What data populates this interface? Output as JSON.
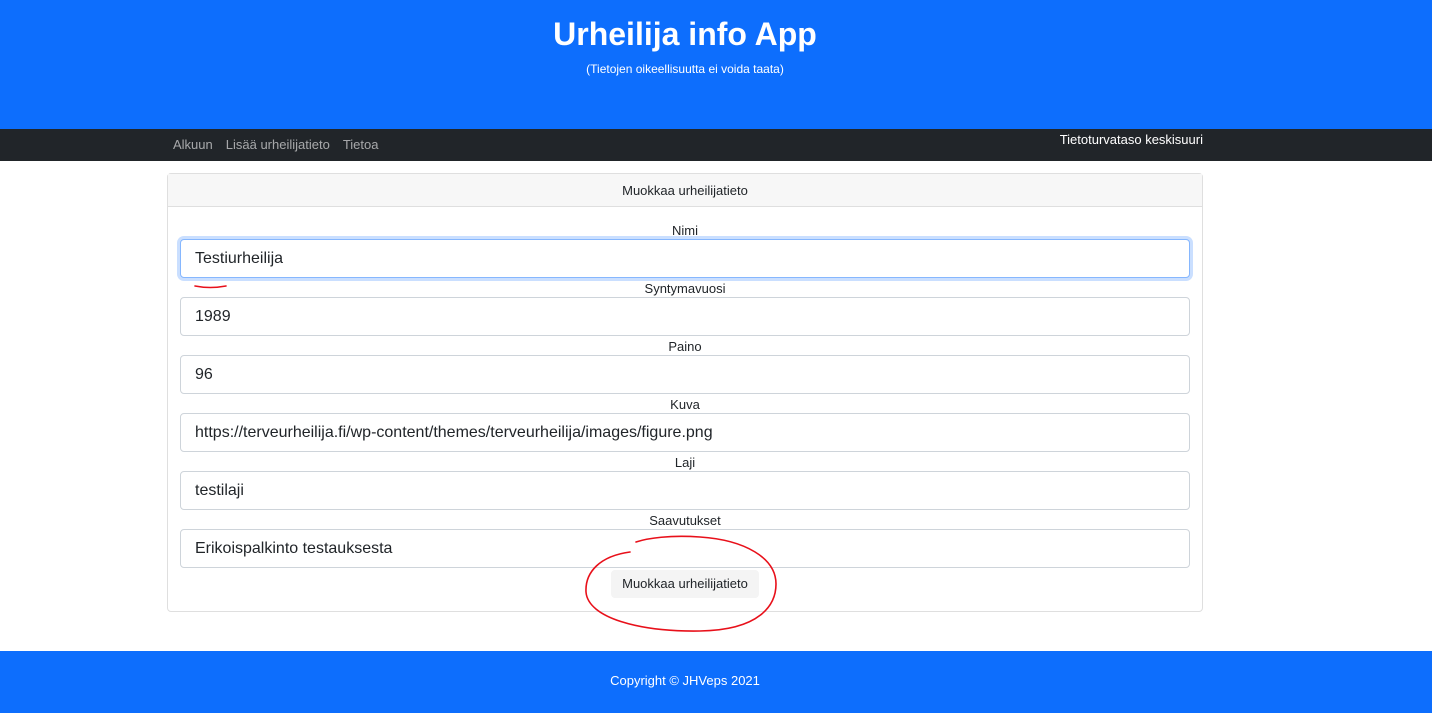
{
  "header": {
    "title": "Urheilija info App",
    "subtitle": "(Tietojen oikeellisuutta ei voida taata)"
  },
  "nav": {
    "items": [
      "Alkuun",
      "Lisää urheilijatieto",
      "Tietoa"
    ],
    "security_level": "Tietoturvataso keskisuuri"
  },
  "form": {
    "title": "Muokkaa urheilijatieto",
    "fields": [
      {
        "label": "Nimi",
        "value": "Testiurheilija"
      },
      {
        "label": "Syntymavuosi",
        "value": "1989"
      },
      {
        "label": "Paino",
        "value": "96"
      },
      {
        "label": "Kuva",
        "value": "https://terveurheilija.fi/wp-content/themes/terveurheilija/images/figure.png"
      },
      {
        "label": "Laji",
        "value": "testilaji"
      },
      {
        "label": "Saavutukset",
        "value": "Erikoispalkinto testauksesta"
      }
    ],
    "submit_label": "Muokkaa urheilijatieto"
  },
  "footer": {
    "copyright": "Copyright © JHVeps 2021"
  },
  "colors": {
    "primary": "#0d6efd",
    "navbar": "#212529",
    "annotation": "#e8101a"
  }
}
